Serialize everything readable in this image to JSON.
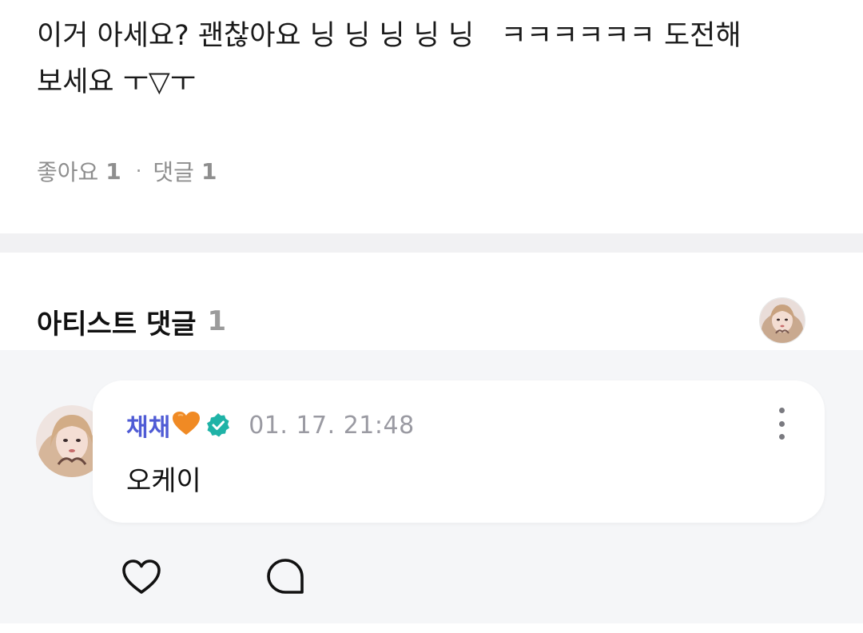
{
  "post": {
    "text": "이거 아세요? 괜찮아요 닝 닝 닝 닝 닝   ㅋㅋㅋㅋㅋㅋ 도전해\n보세요 ㅜ▽ㅜ",
    "likes_label": "좋아요",
    "likes_count": "1",
    "comments_label": "댓글",
    "comments_count": "1",
    "separator": "·"
  },
  "artist_comments": {
    "title": "아티스트 댓글",
    "count": "1"
  },
  "comment": {
    "author": "채채",
    "author_emoji": "🧡",
    "timestamp": "01. 17. 21:48",
    "text": "오케이",
    "verified": true
  },
  "icons": {
    "like": "heart-outline-icon",
    "reply": "speech-bubble-icon",
    "more": "more-vertical-icon",
    "verified": "verified-badge-icon"
  },
  "colors": {
    "author_name": "#4f5bd5",
    "verified_badge": "#1fb3a7",
    "comments_background": "#f5f6f8",
    "divider": "#f1f1f3"
  }
}
